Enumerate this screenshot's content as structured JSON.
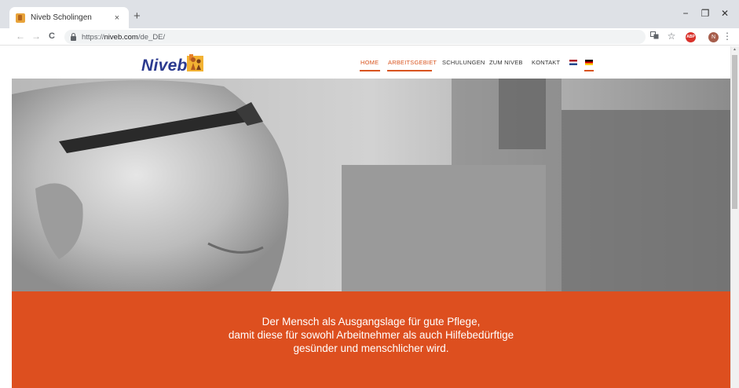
{
  "browser": {
    "tab_title": "Niveb Scholingen",
    "tab_close": "×",
    "new_tab": "+",
    "url_prefix": "https://",
    "url_host": "niveb.com",
    "url_path": "/de_DE/",
    "back": "←",
    "forward": "→",
    "reload": "C",
    "translate_icon": "translate-icon",
    "star": "☆",
    "adblock_label": "ABP",
    "profile_initial": "N",
    "menu": "⋮",
    "minimize": "−",
    "maximize": "❐",
    "close": "✕"
  },
  "site": {
    "logo_text": "Niveb",
    "nav": [
      {
        "label": "HOME",
        "active": true
      },
      {
        "label": "ARBEITSGEBIET",
        "active": true
      },
      {
        "label": "SCHULUNGEN",
        "active": false
      },
      {
        "label": "ZUM NIVEB",
        "active": false
      },
      {
        "label": "KONTAKT",
        "active": false
      }
    ],
    "flags": [
      "nl-flag-icon",
      "de-flag-icon"
    ],
    "tagline": [
      "Der Mensch als Ausgangslage für gute Pflege,",
      "damit diese für sowohl Arbeitnehmer als auch Hilfebedürftige",
      "gesünder und menschlicher wird."
    ]
  },
  "colors": {
    "accent": "#dd4f1f",
    "logo_blue": "#2b3a8f",
    "chrome_bg": "#dee1e6"
  }
}
